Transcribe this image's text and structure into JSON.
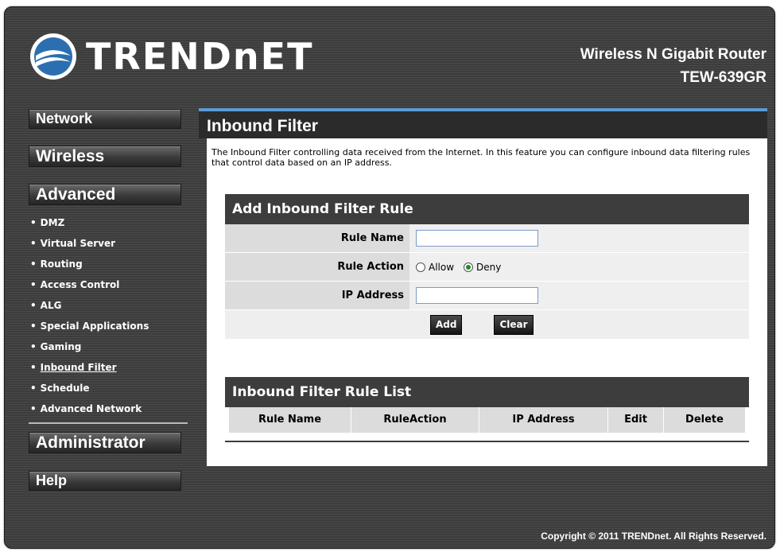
{
  "header": {
    "logo_text": "TRENDnET",
    "product_title": "Wireless N Gigabit Router",
    "product_model": "TEW-639GR"
  },
  "nav": {
    "network": "Network",
    "wireless": "Wireless",
    "advanced": "Advanced",
    "administrator": "Administrator",
    "help": "Help",
    "advanced_items": [
      {
        "label": "DMZ"
      },
      {
        "label": "Virtual Server"
      },
      {
        "label": "Routing"
      },
      {
        "label": "Access Control"
      },
      {
        "label": "ALG"
      },
      {
        "label": "Special Applications"
      },
      {
        "label": "Gaming"
      },
      {
        "label": "Inbound Filter",
        "active": true
      },
      {
        "label": "Schedule"
      },
      {
        "label": "Advanced Network"
      }
    ]
  },
  "page": {
    "title": "Inbound Filter",
    "description": "The Inbound Filter controlling data received from the Internet. In this feature you can configure inbound data filtering rules that control data based on an IP address."
  },
  "add_rule": {
    "heading": "Add Inbound Filter Rule",
    "rule_name_label": "Rule Name",
    "rule_name_value": "",
    "rule_action_label": "Rule Action",
    "allow_label": "Allow",
    "deny_label": "Deny",
    "selected_action": "Deny",
    "ip_address_label": "IP Address",
    "ip_address_value": "",
    "add_button": "Add",
    "clear_button": "Clear"
  },
  "rule_list": {
    "heading": "Inbound Filter Rule List",
    "columns": [
      "Rule Name",
      "RuleAction",
      "IP Address",
      "Edit",
      "Delete"
    ]
  },
  "footer": {
    "copyright": "Copyright © 2011 TRENDnet. All Rights Reserved."
  },
  "colors": {
    "accent_bar": "#5b9bd5",
    "radio_selected": "#1e8b1e"
  }
}
